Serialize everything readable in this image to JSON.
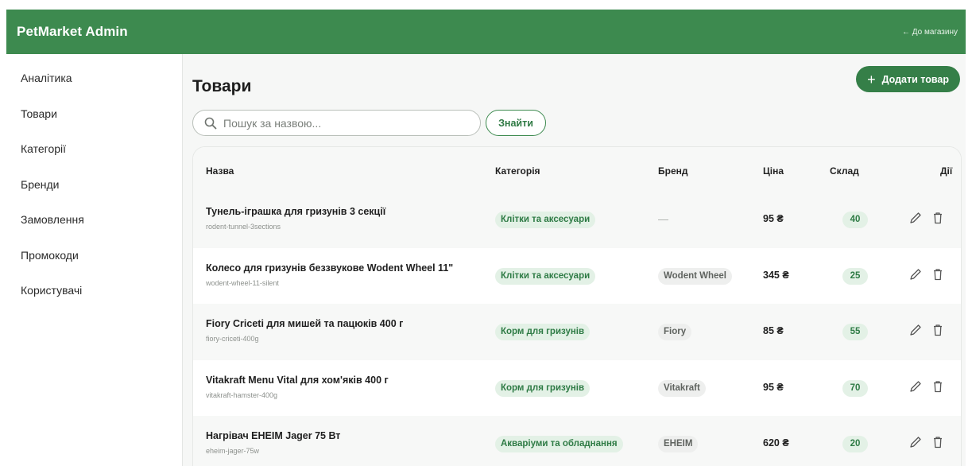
{
  "header": {
    "brand": "PetMarket Admin",
    "back_link": "← До магазину"
  },
  "sidebar": {
    "items": [
      {
        "label": "Аналітика"
      },
      {
        "label": "Товари"
      },
      {
        "label": "Категорії"
      },
      {
        "label": "Бренди"
      },
      {
        "label": "Замовлення"
      },
      {
        "label": "Промокоди"
      },
      {
        "label": "Користувачі"
      }
    ]
  },
  "main": {
    "title": "Товари",
    "add_button": {
      "icon": "plus-icon",
      "label": "Додати товар"
    },
    "search": {
      "placeholder": "Пошук за назвою...",
      "value": "",
      "button_label": "Знайти",
      "icon": "search-icon"
    }
  },
  "table": {
    "columns": [
      "Назва",
      "Категорія",
      "Бренд",
      "Ціна",
      "Склад",
      "Дії"
    ],
    "rows": [
      {
        "name": "Тунель-іграшка для гризунів 3 секції",
        "slug": "rodent-tunnel-3sections",
        "category": "Клітки та аксесуари",
        "brand": "—",
        "price": "95 ₴",
        "stock": "40"
      },
      {
        "name": "Колесо для гризунів беззвукове Wodent Wheel 11\"",
        "slug": "wodent-wheel-11-silent",
        "category": "Клітки та аксесуари",
        "brand": "Wodent Wheel",
        "price": "345 ₴",
        "stock": "25"
      },
      {
        "name": "Fiory Criceti для мишей та пацюків 400 г",
        "slug": "fiory-criceti-400g",
        "category": "Корм для гризунів",
        "brand": "Fiory",
        "price": "85 ₴",
        "stock": "55"
      },
      {
        "name": "Vitakraft Menu Vital для хом'яків 400 г",
        "slug": "vitakraft-hamster-400g",
        "category": "Корм для гризунів",
        "brand": "Vitakraft",
        "price": "95 ₴",
        "stock": "70"
      },
      {
        "name": "Нагрівач EHEIM Jager 75 Вт",
        "slug": "eheim-jager-75w",
        "category": "Акваріуми та обладнання",
        "brand": "EHEIM",
        "price": "620 ₴",
        "stock": "20"
      }
    ],
    "row_actions": [
      "pencil-icon",
      "trash-icon"
    ]
  },
  "colors": {
    "brand_green": "#3d8a4f",
    "button_green": "#357f48",
    "chip_green_bg": "#e3f1e6",
    "chip_green_text": "#2e7b45",
    "chip_gray_bg": "#eeefee"
  }
}
